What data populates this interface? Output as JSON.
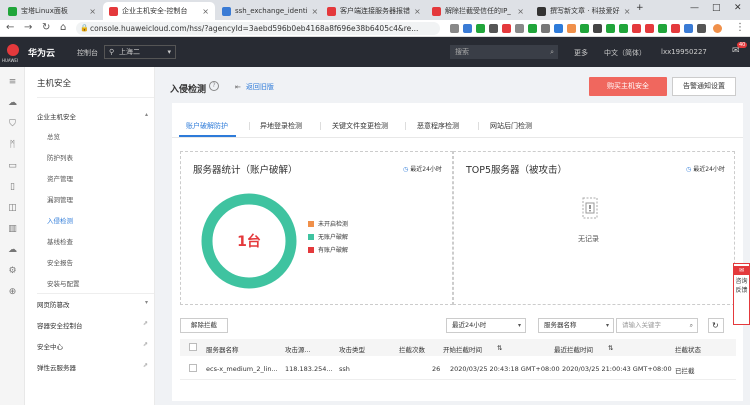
{
  "browser": {
    "tabs": [
      {
        "label": "宝塔Linux面板",
        "color": "#20a53a"
      },
      {
        "label": "企业主机安全-控制台",
        "color": "#e4393c",
        "active": true
      },
      {
        "label": "ssh_exchange_identi",
        "color": "#3a7bd5"
      },
      {
        "label": "客户端连接服务器报错",
        "color": "#e4393c"
      },
      {
        "label": "解除拦截受信任的IP_",
        "color": "#e4393c"
      },
      {
        "label": "撰写新文章 · 科技爱好",
        "color": "#333"
      }
    ],
    "url": "console.huaweicloud.com/hss/?agencyId=3aebd596b0eb4168a8f696e38b6405c4&re..."
  },
  "topnav": {
    "logo_text": "HUAWEI",
    "brand": "华为云",
    "console": "控制台",
    "region": "上海二",
    "search_placeholder": "搜索",
    "more": "更多",
    "language": "中文（简体）",
    "user": "lxx19950227",
    "badge": "40"
  },
  "sidebar": {
    "title": "主机安全",
    "group1": "企业主机安全",
    "subitems": [
      "总览",
      "防护列表",
      "资产管理",
      "漏洞管理",
      "入侵检测",
      "基线检查",
      "安全报告",
      "安装与配置"
    ],
    "items": [
      "网页防篡改",
      "容器安全控制台",
      "安全中心",
      "弹性云服务器"
    ]
  },
  "main": {
    "title": "入侵检测",
    "back_link": "返回旧版",
    "buy_button": "购买主机安全",
    "alert_button": "告警通知设置",
    "tabs": [
      "账户破解防护",
      "异地登录检测",
      "关键文件变更检测",
      "恶意程序检测",
      "网站后门检测"
    ],
    "stat_title": "服务器统计（账户破解）",
    "stat_time": "最近24小时",
    "donut_value": "1台",
    "legend": [
      {
        "label": "未开启检测",
        "color": "#f0904a"
      },
      {
        "label": "无账户破解",
        "color": "#3fc3a0"
      },
      {
        "label": "有账户破解",
        "color": "#e4393c"
      }
    ],
    "top5_title": "TOP5服务器（被攻击）",
    "top5_time": "最近24小时",
    "no_record": "无记录",
    "unblock_button": "解除拦截",
    "time_select": "最近24小时",
    "field_select": "服务器名称",
    "keyword_placeholder": "请输入关键字",
    "refresh_icon": "refresh-icon",
    "table_headers": [
      "服务器名称",
      "攻击源...",
      "攻击类型",
      "拦截次数",
      "开始拦截时间",
      "最近拦截时间",
      "拦截状态"
    ],
    "rows": [
      [
        "ecs-x_medium_2_lin...",
        "118.183.254...",
        "ssh",
        "26",
        "2020/03/25 20:43:18 GMT+08:00",
        "2020/03/25 21:00:43 GMT+08:00",
        "已拦截"
      ]
    ]
  },
  "feedback": {
    "icon": "chat-icon",
    "label1": "咨询",
    "label2": "反馈"
  }
}
